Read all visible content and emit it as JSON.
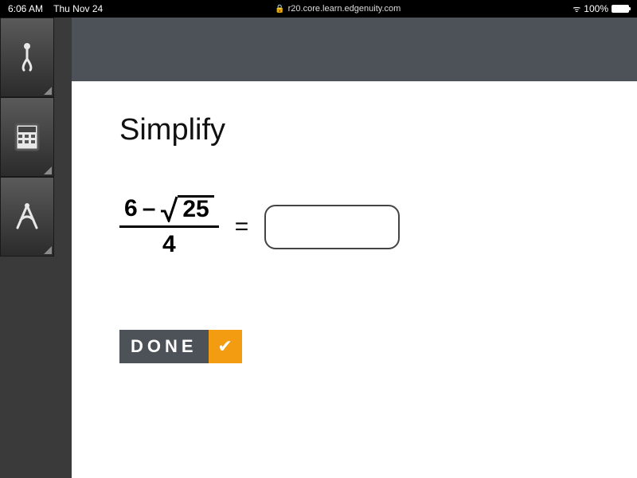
{
  "status": {
    "time": "6:06 AM",
    "date": "Thu Nov 24",
    "url": "r20.core.learn.edgenuity.com",
    "battery_pct": "100%"
  },
  "tools": [
    "clip",
    "calculator",
    "compass"
  ],
  "page": {
    "title": "Simplify",
    "expression": {
      "numerator_left": "6",
      "minus": "–",
      "radicand": "25",
      "denominator": "4"
    },
    "equals": "=",
    "answer_placeholder": "",
    "done_label": "DONE"
  }
}
